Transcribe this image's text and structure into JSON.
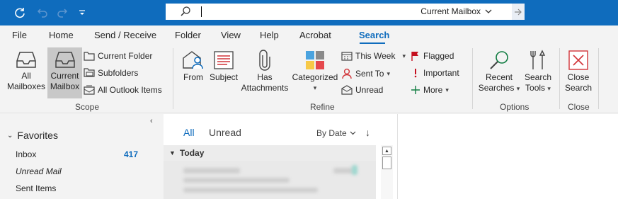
{
  "titlebar": {
    "scope_label": "Current Mailbox",
    "icons": [
      "sync-icon",
      "undo-icon",
      "redo-icon",
      "customize-qat-icon",
      "search-icon",
      "chevron-down-icon",
      "arrow-right-icon"
    ]
  },
  "tabs": [
    "File",
    "Home",
    "Send / Receive",
    "Folder",
    "View",
    "Help",
    "Acrobat",
    "Search"
  ],
  "active_tab": "Search",
  "ribbon": {
    "scope": {
      "all_mailboxes": [
        "All",
        "Mailboxes"
      ],
      "current_mailbox": [
        "Current",
        "Mailbox"
      ],
      "current_folder": "Current Folder",
      "subfolders": "Subfolders",
      "all_outlook_items": "All Outlook Items",
      "group": "Scope"
    },
    "refine": {
      "from": "From",
      "subject": "Subject",
      "has_attachments": [
        "Has",
        "Attachments"
      ],
      "categorized": "Categorized",
      "this_week": "This Week",
      "sent_to": "Sent To",
      "unread": "Unread",
      "flagged": "Flagged",
      "important": "Important",
      "more": "More",
      "group": "Refine"
    },
    "options": {
      "recent_searches": [
        "Recent",
        "Searches"
      ],
      "search_tools": [
        "Search",
        "Tools"
      ],
      "group": "Options"
    },
    "close": {
      "close_search": [
        "Close",
        "Search"
      ],
      "group": "Close"
    }
  },
  "folderpane": {
    "favorites": "Favorites",
    "items": [
      {
        "label": "Inbox",
        "count": "417"
      },
      {
        "label": "Unread Mail"
      },
      {
        "label": "Sent Items"
      }
    ]
  },
  "messagelist": {
    "tab_all": "All",
    "tab_unread": "Unread",
    "sort_label": "By Date",
    "group_today": "Today"
  },
  "colors": {
    "accent": "#0f6cbd",
    "close_red": "#d13438",
    "flag_red": "#c50f1f",
    "recent_green": "#107c41"
  }
}
